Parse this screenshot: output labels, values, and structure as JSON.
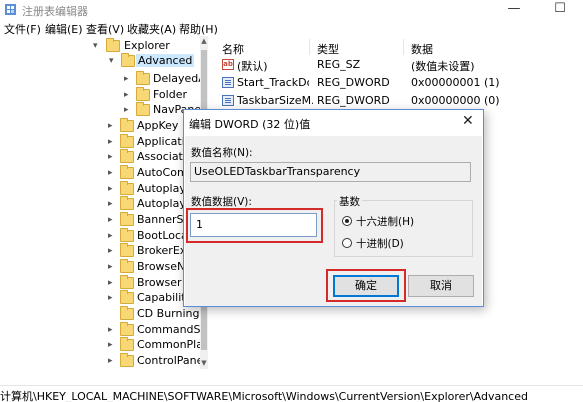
{
  "window": {
    "title": "注册表编辑器",
    "minimize": "—",
    "maximize": "☐"
  },
  "menu": [
    "文件(F)",
    "编辑(E)",
    "查看(V)",
    "收藏夹(A)",
    "帮助(H)"
  ],
  "tree": [
    {
      "label": "Explorer",
      "arrow": "▾"
    },
    {
      "label": "Advanced",
      "arrow": "▾"
    },
    {
      "label": "DelayedAp",
      "arrow": "▸"
    },
    {
      "label": "Folder",
      "arrow": "▸"
    },
    {
      "label": "NavPane",
      "arrow": "▸"
    },
    {
      "label": "AppKey",
      "arrow": "▸"
    },
    {
      "label": "Applicatio",
      "arrow": "▸"
    },
    {
      "label": "Associatio",
      "arrow": "▸"
    },
    {
      "label": "AutoCom",
      "arrow": "▸"
    },
    {
      "label": "AutoplayH",
      "arrow": "▸"
    },
    {
      "label": "AutoplayH",
      "arrow": "▸"
    },
    {
      "label": "BannerSto",
      "arrow": "▸"
    },
    {
      "label": "BootLocal",
      "arrow": "▸"
    },
    {
      "label": "BrokerExt",
      "arrow": "▸"
    },
    {
      "label": "BrowseNe",
      "arrow": "▸"
    },
    {
      "label": "Browser H",
      "arrow": "▸"
    },
    {
      "label": "Capabiliti",
      "arrow": "▸"
    },
    {
      "label": "CD Burning",
      "arrow": ""
    },
    {
      "label": "CommandSto",
      "arrow": "▸"
    },
    {
      "label": "CommonPlac",
      "arrow": "▸"
    },
    {
      "label": "ControlPanel",
      "arrow": "▸"
    }
  ],
  "list": {
    "headers": {
      "name": "名称",
      "type": "类型",
      "data": "数据"
    },
    "rows": [
      {
        "icon": "ab",
        "name": "(默认)",
        "type": "REG_SZ",
        "data": "(数值未设置)"
      },
      {
        "icon": "bin",
        "name": "Start_TrackDocs",
        "type": "REG_DWORD",
        "data": "0x00000001 (1)"
      },
      {
        "icon": "bin",
        "name": "TaskbarSizeM...",
        "type": "REG_DWORD",
        "data": "0x00000000 (0)"
      }
    ]
  },
  "status": "计算机\\HKEY_LOCAL_MACHINE\\SOFTWARE\\Microsoft\\Windows\\CurrentVersion\\Explorer\\Advanced",
  "dialog": {
    "title": "编辑 DWORD (32 位)值",
    "close": "✕",
    "name_label": "数值名称(N):",
    "name_value": "UseOLEDTaskbarTransparency",
    "data_label": "数值数据(V):",
    "data_value": "1",
    "base_label": "基数",
    "hex_label": "十六进制(H)",
    "dec_label": "十进制(D)",
    "ok_label": "确定",
    "cancel_label": "取消"
  }
}
